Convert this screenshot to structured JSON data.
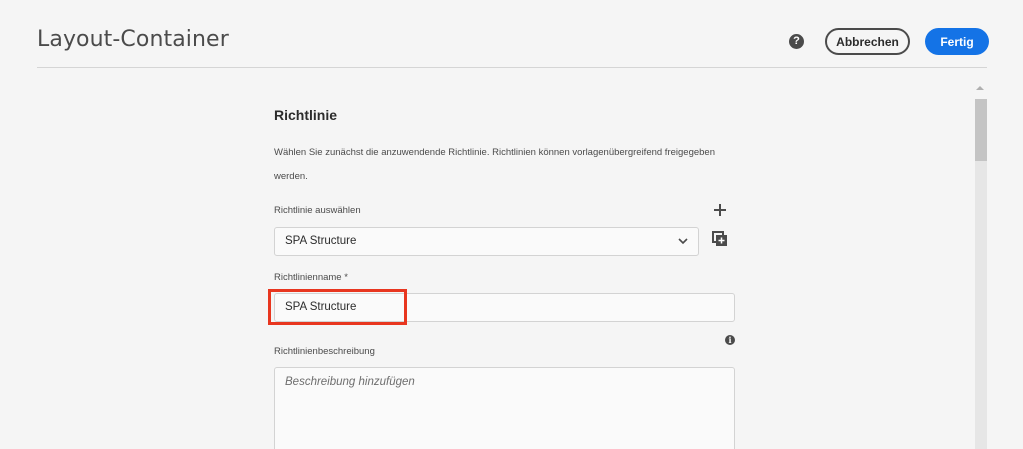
{
  "header": {
    "title": "Layout-Container",
    "help_icon": "help-icon",
    "cancel_label": "Abbrechen",
    "done_label": "Fertig"
  },
  "policy": {
    "section_title": "Richtlinie",
    "description": "Wählen Sie zunächst die anzuwendende Richtlinie. Richtlinien können vorlagenübergreifend freigegeben werden.",
    "select_label": "Richtlinie auswählen",
    "select_value": "SPA Structure",
    "name_label": "Richtlinienname *",
    "name_value": "SPA Structure",
    "description_label": "Richtlinienbeschreibung",
    "description_placeholder": "Beschreibung hinzufügen"
  },
  "colors": {
    "primary": "#1473e6",
    "highlight": "#e8361f"
  }
}
